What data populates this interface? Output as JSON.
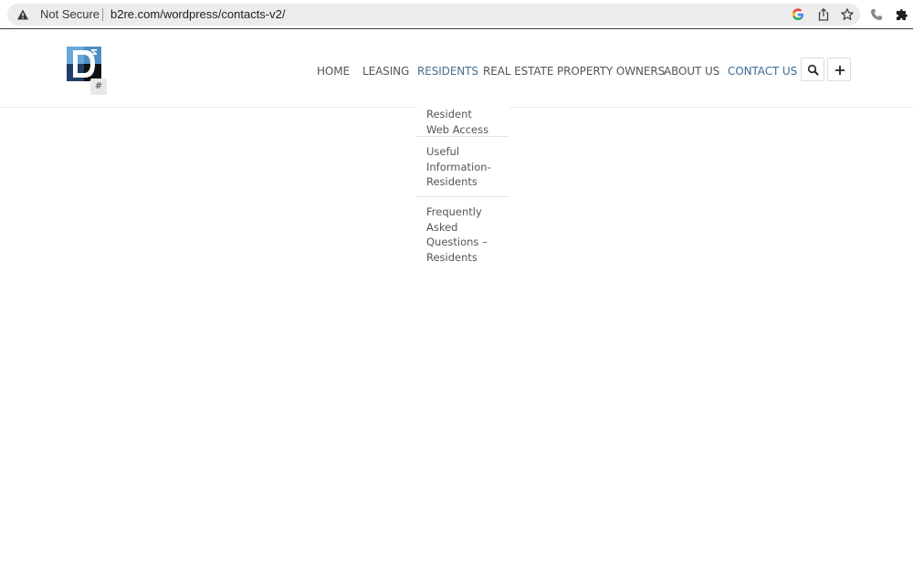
{
  "browser": {
    "security_label": "Not Secure",
    "url_domain": "b2re.com",
    "url_path": "/wordpress/contacts-v2/",
    "icons": [
      "warning-icon",
      "google-icon",
      "share-icon",
      "bookmark-star-icon",
      "phone-icon",
      "extensions-puzzle-icon"
    ]
  },
  "header": {
    "logo_alt": "B2",
    "hash_chip": "#",
    "nav": [
      {
        "label": "HOME"
      },
      {
        "label": "LEASING"
      },
      {
        "label": "RESIDENTS"
      },
      {
        "label": "REAL ESTATE"
      },
      {
        "label": "PROPERTY OWNERS"
      },
      {
        "label": "ABOUT US"
      },
      {
        "label": "CONTACT US"
      }
    ],
    "search_icon": "search-icon",
    "plus_icon": "plus-icon"
  },
  "dropdown": {
    "items": [
      {
        "lines": [
          "Resident",
          "Web Access"
        ]
      },
      {
        "lines": [
          "Useful",
          "Information-",
          "Residents"
        ]
      },
      {
        "lines": [
          "Frequently",
          "Asked",
          "Questions –",
          "Residents"
        ]
      }
    ]
  },
  "colors": {
    "active_nav": "#4a6c8c",
    "nav_text": "#555555",
    "logo_blue": "#4d8fc4"
  }
}
